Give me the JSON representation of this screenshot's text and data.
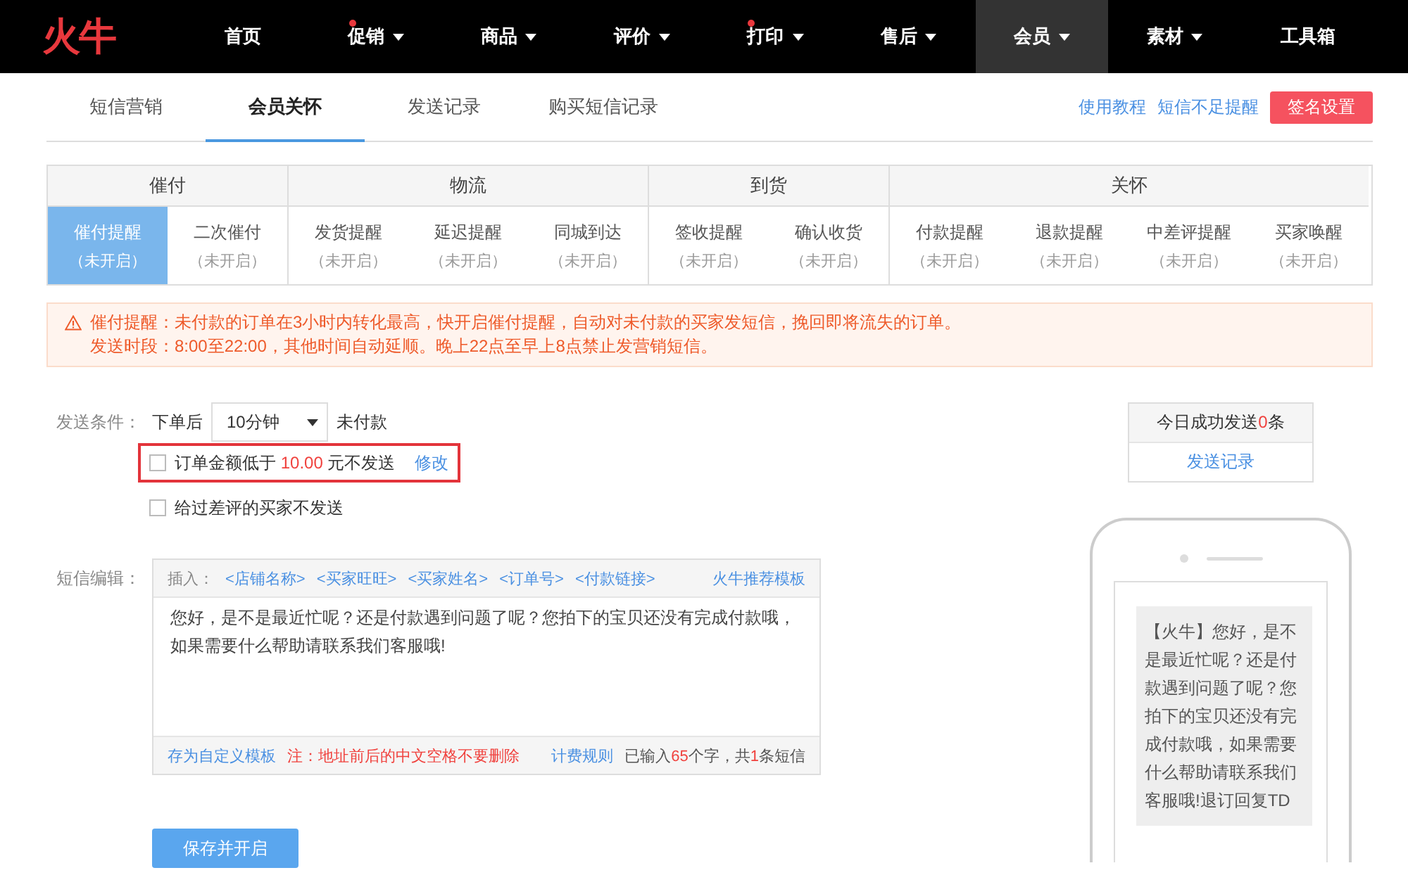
{
  "nav": {
    "logo": "火牛",
    "items": [
      {
        "label": "首页",
        "selected": false,
        "dot": false,
        "dropdown": false
      },
      {
        "label": "促销",
        "selected": false,
        "dot": true,
        "dropdown": true
      },
      {
        "label": "商品",
        "selected": false,
        "dot": false,
        "dropdown": true
      },
      {
        "label": "评价",
        "selected": false,
        "dot": false,
        "dropdown": true
      },
      {
        "label": "打印",
        "selected": false,
        "dot": true,
        "dropdown": true
      },
      {
        "label": "售后",
        "selected": false,
        "dot": false,
        "dropdown": true
      },
      {
        "label": "会员",
        "selected": true,
        "dot": false,
        "dropdown": true
      },
      {
        "label": "素材",
        "selected": false,
        "dot": false,
        "dropdown": true
      },
      {
        "label": "工具箱",
        "selected": false,
        "dot": false,
        "dropdown": false
      }
    ]
  },
  "subnav": {
    "tabs": [
      {
        "label": "短信营销",
        "selected": false
      },
      {
        "label": "会员关怀",
        "selected": true
      },
      {
        "label": "发送记录",
        "selected": false
      },
      {
        "label": "购买短信记录",
        "selected": false
      }
    ],
    "links": [
      "使用教程",
      "短信不足提醒"
    ],
    "button": "签名设置"
  },
  "categories": [
    {
      "group": "催付",
      "items": [
        {
          "label": "催付提醒",
          "status": "（未开启）",
          "selected": true
        },
        {
          "label": "二次催付",
          "status": "（未开启）",
          "selected": false
        }
      ]
    },
    {
      "group": "物流",
      "items": [
        {
          "label": "发货提醒",
          "status": "（未开启）",
          "selected": false
        },
        {
          "label": "延迟提醒",
          "status": "（未开启）",
          "selected": false
        },
        {
          "label": "同城到达",
          "status": "（未开启）",
          "selected": false
        }
      ]
    },
    {
      "group": "到货",
      "items": [
        {
          "label": "签收提醒",
          "status": "（未开启）",
          "selected": false
        },
        {
          "label": "确认收货",
          "status": "（未开启）",
          "selected": false
        }
      ]
    },
    {
      "group": "关怀",
      "items": [
        {
          "label": "付款提醒",
          "status": "（未开启）",
          "selected": false
        },
        {
          "label": "退款提醒",
          "status": "（未开启）",
          "selected": false
        },
        {
          "label": "中差评提醒",
          "status": "（未开启）",
          "selected": false
        },
        {
          "label": "买家唤醒",
          "status": "（未开启）",
          "selected": false
        }
      ]
    }
  ],
  "alert": {
    "lines": [
      "催付提醒：未付款的订单在3小时内转化最高，快开启催付提醒，自动对未付款的买家发短信，挽回即将流失的订单。",
      "发送时段：8:00至22:00，其他时间自动延顺。晚上22点至早上8点禁止发营销短信。"
    ]
  },
  "conditions": {
    "label": "发送条件：",
    "prefix": "下单后",
    "select": "10分钟",
    "suffix": "未付款",
    "options": [
      {
        "kind": "amount",
        "before": "订单金额低于 ",
        "amount": "10.00",
        "after": " 元不发送",
        "link": "修改",
        "checked": false,
        "highlighted": true
      },
      {
        "kind": "plain",
        "text": "给过差评的买家不发送",
        "checked": false,
        "highlighted": false
      }
    ]
  },
  "editor": {
    "label": "短信编辑：",
    "insert_label": "插入：",
    "tokens": [
      "<店铺名称>",
      "<买家旺旺>",
      "<买家姓名>",
      "<订单号>",
      "<付款链接>"
    ],
    "template_link": "火牛推荐模板",
    "content": "您好，是不是最近忙呢？还是付款遇到问题了呢？您拍下的宝贝还没有完成付款哦，如果需要什么帮助请联系我们客服哦!",
    "save_template": "存为自定义模板",
    "note": "注：地址前后的中文空格不要删除",
    "rules_link": "计费规则",
    "count": {
      "before": "已输入",
      "chars": "65",
      "middle": "个字，共",
      "messages": "1",
      "after": "条短信"
    }
  },
  "stats": {
    "before": "今日成功发送",
    "count": "0",
    "after": "条",
    "link": "发送记录"
  },
  "phone": {
    "message": "【火牛】您好，是不是最近忙呢？还是付款遇到问题了呢？您拍下的宝贝还没有完成付款哦，如果需要什么帮助请联系我们客服哦!退订回复TD"
  },
  "save_button": "保存并开启"
}
